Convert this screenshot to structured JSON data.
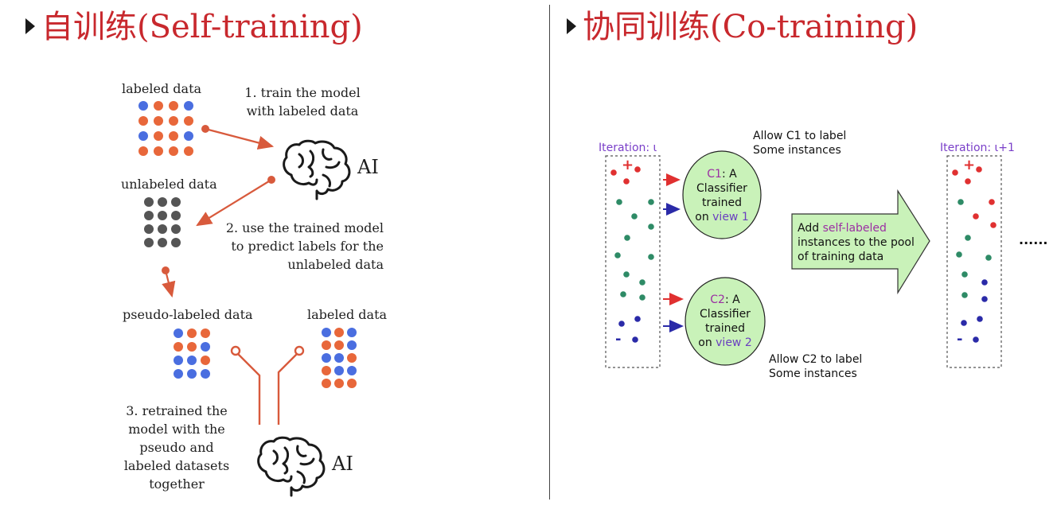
{
  "left": {
    "title": "自训练(Self-training)",
    "labeled_data_label": "labeled data",
    "unlabeled_data_label": "unlabeled data",
    "pseudo_labeled_label": "pseudo-labeled data",
    "labeled_data_label_2": "labeled data",
    "step1": [
      "1. train the model",
      "with labeled data"
    ],
    "step2": [
      "2. use the trained model",
      "to predict labels for the",
      "unlabeled data"
    ],
    "step3": [
      "3. retrained the",
      "model with the",
      "pseudo and",
      "labeled datasets",
      "together"
    ],
    "ai_label_top": "AI",
    "ai_label_bottom": "AI",
    "colors": {
      "blue": "#4a6ee0",
      "orange": "#e8673a",
      "gray": "#555555",
      "arrow": "#d85a3c"
    }
  },
  "right": {
    "title": "协同训练(Co-training)",
    "iteration_left": "Iteration: ι",
    "iteration_right": "Iteration: ι+1",
    "plus_left": "+",
    "minus_left": "-",
    "plus_right": "+",
    "minus_right": "-",
    "c1": {
      "name": "C1",
      "rest": ": A",
      "line2": "Classifier",
      "line3": "trained",
      "line4_prefix": "on ",
      "view": "view 1"
    },
    "c2": {
      "name": "C2",
      "rest": ": A",
      "line2": "Classifier",
      "line3": "trained",
      "line4_prefix": "on ",
      "view": "view 2"
    },
    "allow_c1": [
      "Allow C1 to label",
      "Some instances"
    ],
    "allow_c2": [
      "Allow C2 to label",
      "Some instances"
    ],
    "big_arrow": {
      "line1_prefix": "Add ",
      "line1_highlight": "self-labeled",
      "line2": "instances to the pool",
      "line3": "of training data"
    },
    "ellipsis": "......",
    "colors": {
      "red": "#e03030",
      "green": "#2e8b66",
      "navy": "#2a2aa8",
      "ellipse_fill": "#c9f2b9",
      "arrow_fill": "#c9f2b9"
    }
  }
}
